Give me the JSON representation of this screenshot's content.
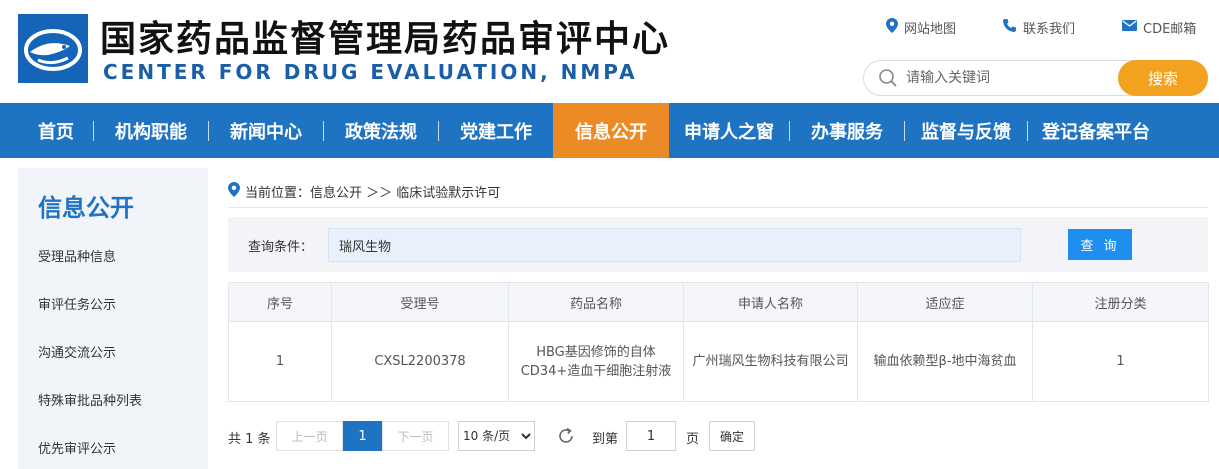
{
  "header": {
    "title_cn": "国家药品监督管理局药品审评中心",
    "title_en": "CENTER FOR DRUG EVALUATION, NMPA",
    "links": {
      "sitemap": "网站地图",
      "contact": "联系我们",
      "mail": "CDE邮箱"
    },
    "search": {
      "placeholder": "请输入关键词",
      "button": "搜索"
    },
    "brand_color": "#1e73c3",
    "accent_color": "#f3a220"
  },
  "nav": {
    "items": [
      {
        "label": "首页"
      },
      {
        "label": "机构职能"
      },
      {
        "label": "新闻中心"
      },
      {
        "label": "政策法规"
      },
      {
        "label": "党建工作"
      },
      {
        "label": "信息公开",
        "active": true
      },
      {
        "label": "申请人之窗"
      },
      {
        "label": "办事服务"
      },
      {
        "label": "监督与反馈"
      },
      {
        "label": "登记备案平台"
      }
    ]
  },
  "sidebar": {
    "title": "信息公开",
    "items": [
      {
        "label": "受理品种信息"
      },
      {
        "label": "审评任务公示"
      },
      {
        "label": "沟通交流公示"
      },
      {
        "label": "特殊审批品种列表"
      },
      {
        "label": "优先审评公示"
      }
    ]
  },
  "breadcrumb": {
    "text": "当前位置：信息公开 ＞＞ 临床试验默示许可"
  },
  "query": {
    "label": "查询条件：",
    "value": "瑞风生物",
    "button": "查 询"
  },
  "table": {
    "headers": [
      "序号",
      "受理号",
      "药品名称",
      "申请人名称",
      "适应症",
      "注册分类"
    ],
    "rows": [
      {
        "index": "1",
        "accept_no": "CXSL2200378",
        "drug_name": "HBG基因修饰的自体CD34+造血干细胞注射液",
        "applicant": "广州瑞风生物科技有限公司",
        "indication": "输血依赖型β-地中海贫血",
        "category": "1"
      }
    ]
  },
  "pager": {
    "total": "共 1 条",
    "prev": "上一页",
    "current": "1",
    "next": "下一页",
    "page_size": "10 条/页",
    "goto_label": "到第",
    "goto_value": "1",
    "page_label": "页",
    "confirm": "确定"
  }
}
